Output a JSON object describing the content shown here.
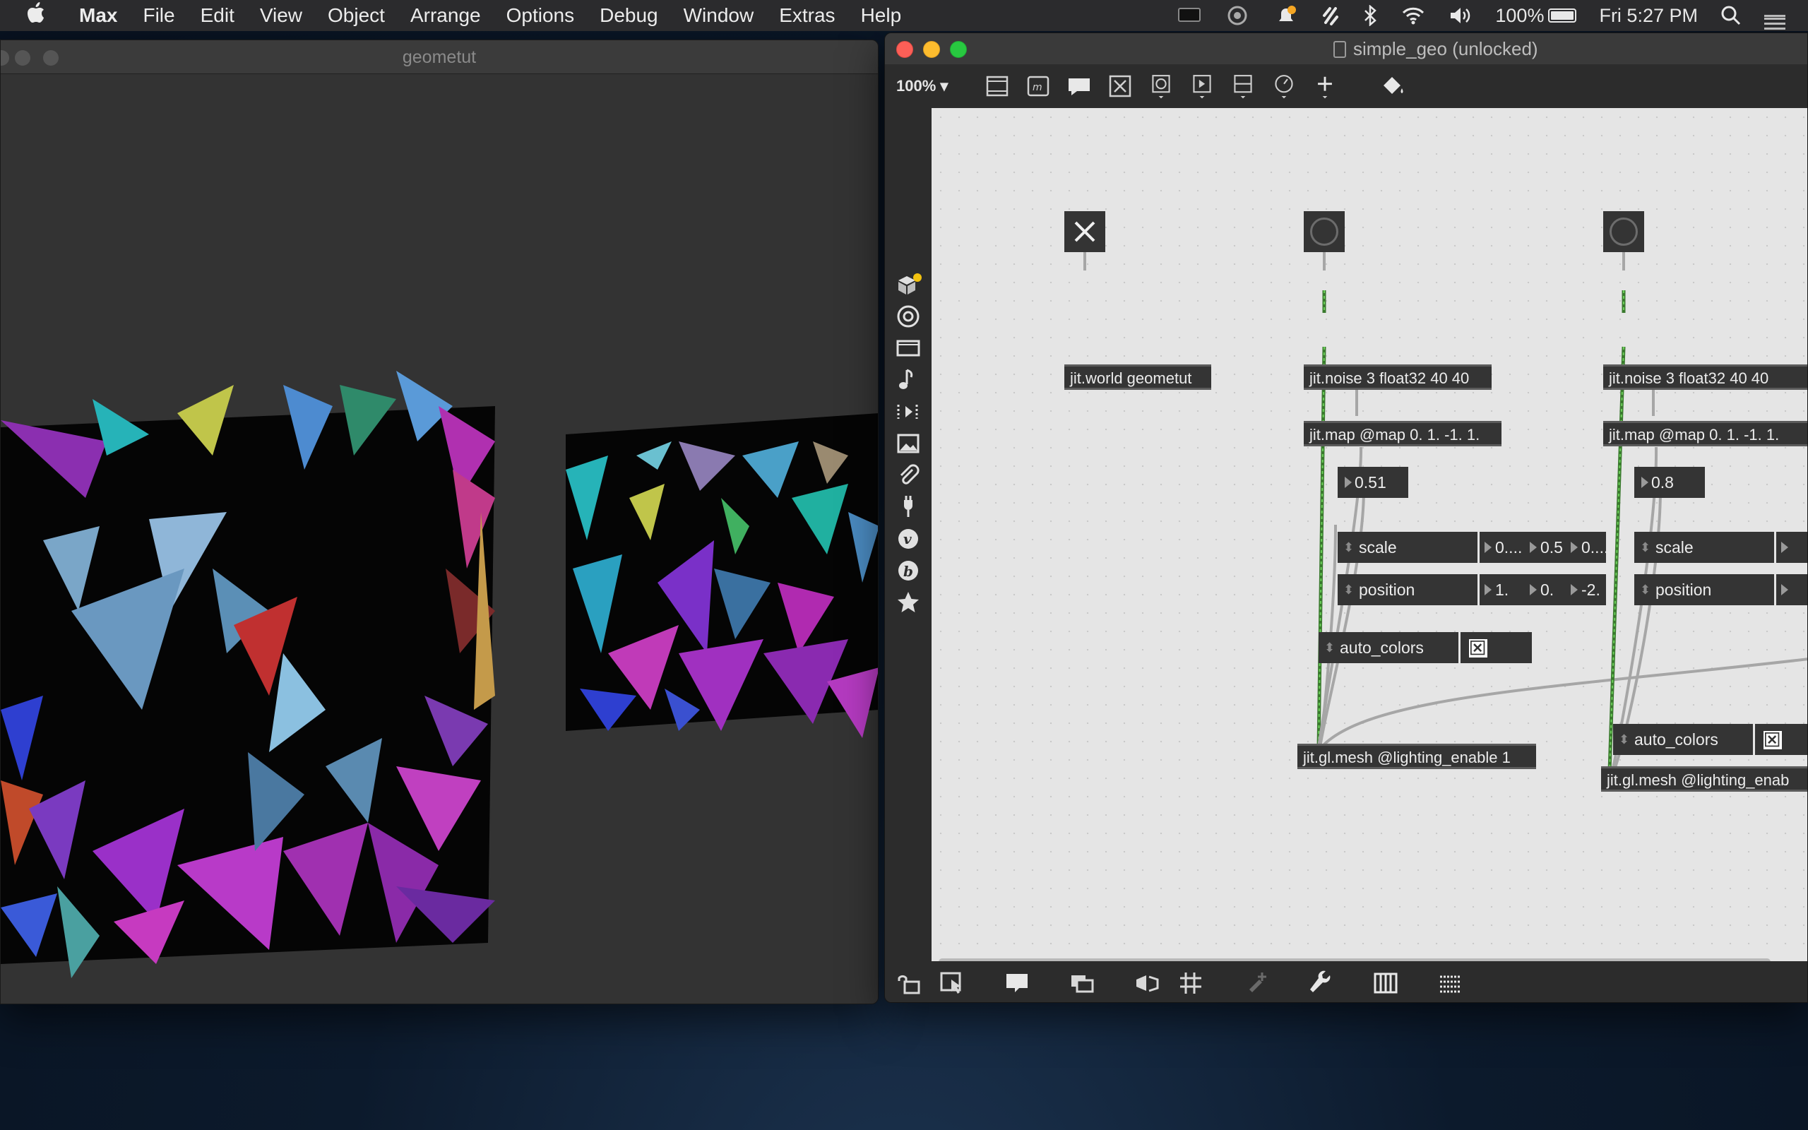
{
  "menubar": {
    "apple": "",
    "items": [
      "Max",
      "File",
      "Edit",
      "View",
      "Object",
      "Arrange",
      "Options",
      "Debug",
      "Window",
      "Extras",
      "Help"
    ],
    "battery": "100%",
    "clock": "Fri 5:27 PM"
  },
  "geo_window": {
    "title": "geometut"
  },
  "patch_window": {
    "title": "simple_geo (unlocked)",
    "zoom": "100% ▾"
  },
  "patch": {
    "world_toggle": {
      "checked": true
    },
    "world": "jit.world geometut",
    "left": {
      "noise": "jit.noise 3 float32 40 40",
      "map": "jit.map @map 0. 1. -1. 1.",
      "number": "0.51",
      "scale_label": "scale",
      "scale_values": [
        "0....",
        "0.5",
        "0...."
      ],
      "position_label": "position",
      "position_values": [
        "1.",
        "0.",
        "-2."
      ],
      "auto_colors_label": "auto_colors",
      "auto_colors_checked": true,
      "mesh": "jit.gl.mesh @lighting_enable 1"
    },
    "right": {
      "noise": "jit.noise 3 float32 40 40",
      "map": "jit.map @map 0. 1. -1. 1.",
      "number": "0.8",
      "scale_label": "scale",
      "position_label": "position",
      "auto_colors_label": "auto_colors",
      "auto_colors_checked": true,
      "mesh": "jit.gl.mesh @lighting_enab"
    }
  },
  "colors": {
    "canvas": "#e5e5e5",
    "object_bg": "#343434",
    "matrix_cord": "#4caa3c",
    "control_cord": "#a6a6a6",
    "light_red": "#fc5f57",
    "light_yellow": "#fdbc2e",
    "light_green": "#28c840"
  },
  "icons": {
    "toolbar": [
      "new-object-icon",
      "message-icon",
      "comment-icon",
      "toggle-icon",
      "button-icon",
      "slider-icon",
      "number-icon",
      "dial-icon",
      "add-icon",
      "format-paint-icon"
    ],
    "sidebar": [
      "packages-icon",
      "target-icon",
      "video-icon",
      "music-icon",
      "sequence-icon",
      "image-icon",
      "clip-icon",
      "plug-icon",
      "v-icon",
      "b-icon",
      "star-icon"
    ],
    "bottombar": [
      "lock-icon",
      "select-icon",
      "presentation-icon",
      "layers-icon",
      "snap-icon",
      "grid-icon",
      "new-snippet-icon",
      "wrench-icon",
      "piano-icon",
      "keyboard-icon"
    ]
  }
}
